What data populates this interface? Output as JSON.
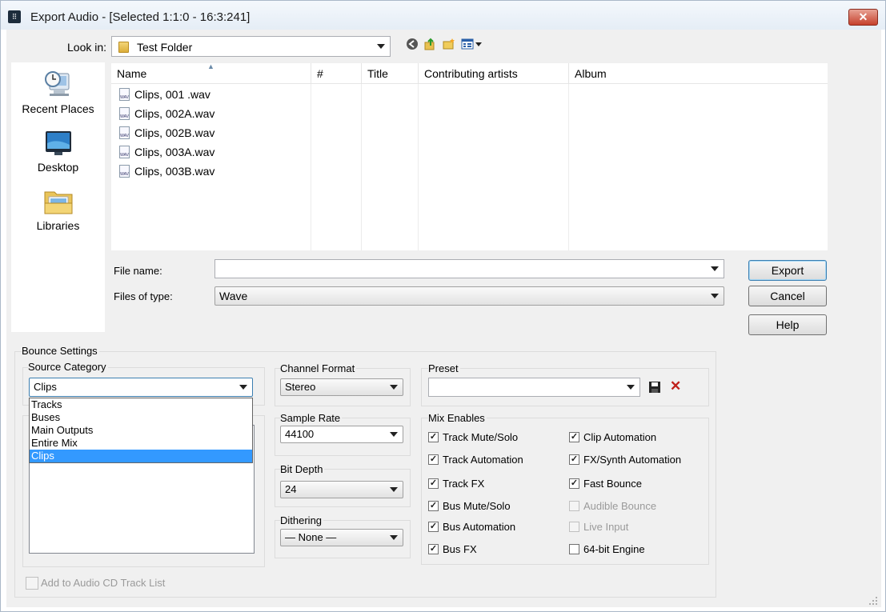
{
  "window": {
    "title": "Export Audio - [Selected 1:1:0 - 16:3:241]",
    "close_glyph": "✕"
  },
  "lookin": {
    "label": "Look in:",
    "value": "Test Folder"
  },
  "sidebar": {
    "items": [
      {
        "label": "Recent Places",
        "icon": "recent-places-icon"
      },
      {
        "label": "Desktop",
        "icon": "desktop-icon"
      },
      {
        "label": "Libraries",
        "icon": "libraries-icon"
      }
    ]
  },
  "filelist": {
    "columns": [
      "Name",
      "#",
      "Title",
      "Contributing artists",
      "Album"
    ],
    "files": [
      "Clips, 001 .wav",
      "Clips, 002A.wav",
      "Clips, 002B.wav",
      "Clips, 003A.wav",
      "Clips, 003B.wav"
    ],
    "file_icon_text": "WAV"
  },
  "form": {
    "filename_label": "File name:",
    "filename_value": "",
    "filetype_label": "Files of type:",
    "filetype_value": "Wave"
  },
  "buttons": {
    "export": "Export",
    "cancel": "Cancel",
    "help": "Help"
  },
  "bounce": {
    "title": "Bounce Settings",
    "source_category": {
      "label": "Source Category",
      "value": "Clips",
      "options": [
        "Tracks",
        "Buses",
        "Main Outputs",
        "Entire Mix",
        "Clips"
      ],
      "selected_index": 4
    },
    "channel_format": {
      "label": "Channel Format",
      "value": "Stereo"
    },
    "sample_rate": {
      "label": "Sample Rate",
      "value": "44100"
    },
    "bit_depth": {
      "label": "Bit Depth",
      "value": "24"
    },
    "dithering": {
      "label": "Dithering",
      "value": "— None —"
    },
    "preset": {
      "label": "Preset",
      "value": ""
    },
    "mix_enables": {
      "label": "Mix Enables",
      "left": [
        {
          "label": "Track Mute/Solo",
          "checked": true
        },
        {
          "label": "Track Automation",
          "checked": true
        },
        {
          "label": "Track FX",
          "checked": true
        },
        {
          "label": "Bus Mute/Solo",
          "checked": true
        },
        {
          "label": "Bus Automation",
          "checked": true
        },
        {
          "label": "Bus FX",
          "checked": true
        }
      ],
      "right": [
        {
          "label": "Clip Automation",
          "checked": true,
          "enabled": true
        },
        {
          "label": "FX/Synth Automation",
          "checked": true,
          "enabled": true
        },
        {
          "label": "Fast Bounce",
          "checked": true,
          "enabled": true
        },
        {
          "label": "Audible Bounce",
          "checked": false,
          "enabled": false
        },
        {
          "label": "Live Input",
          "checked": false,
          "enabled": false
        },
        {
          "label": "64-bit Engine",
          "checked": false,
          "enabled": true
        }
      ]
    },
    "add_to_cd": {
      "label": "Add to Audio CD Track List",
      "checked": false,
      "enabled": false
    }
  },
  "colors": {
    "selection": "#3399ff",
    "titlebar": "#e5edf6",
    "close": "#c6412d",
    "delete_x": "#c0201a"
  }
}
